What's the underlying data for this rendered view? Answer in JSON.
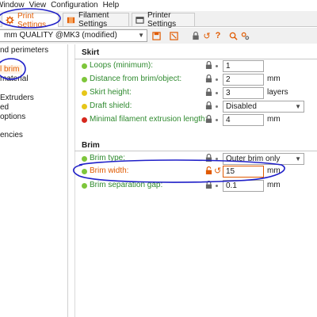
{
  "menu": [
    "Window",
    "View",
    "Configuration",
    "Help"
  ],
  "tabs": [
    {
      "label": "Print Settings",
      "icon": "gear-icon",
      "active": true
    },
    {
      "label": "Filament Settings",
      "icon": "filament-spool-icon",
      "active": false
    },
    {
      "label": "Printer Settings",
      "icon": "printer-icon",
      "active": false
    }
  ],
  "preset": {
    "value": "mm QUALITY @MK3 (modified)",
    "tools": [
      "save-icon",
      "delete-icon",
      "lock-icon",
      "undo-arrow-icon",
      "help-icon",
      "search-icon",
      "compare-icon"
    ]
  },
  "tree": {
    "items": [
      "nd perimeters",
      "l brim",
      "material",
      "Extruders",
      "ed",
      "options",
      "encies"
    ],
    "selected_index": 1
  },
  "sections": {
    "skirt": {
      "title": "Skirt",
      "rows": [
        {
          "label": "Loops (minimum):",
          "value": "1",
          "unit": "",
          "dot": "green"
        },
        {
          "label": "Distance from brim/object:",
          "value": "2",
          "unit": "mm",
          "dot": "green"
        },
        {
          "label": "Skirt height:",
          "value": "3",
          "unit": "layers",
          "dot": "yellow"
        },
        {
          "label": "Draft shield:",
          "value": "Disabled",
          "unit": "",
          "dot": "yellow",
          "type": "combo"
        },
        {
          "label": "Minimal filament extrusion length:",
          "value": "4",
          "unit": "mm",
          "dot": "red"
        }
      ]
    },
    "brim": {
      "title": "Brim",
      "rows": [
        {
          "label": "Brim type:",
          "value": "Outer brim only",
          "unit": "",
          "dot": "green",
          "type": "combo"
        },
        {
          "label": "Brim width:",
          "value": "15",
          "unit": "mm",
          "dot": "green",
          "modified": true
        },
        {
          "label": "Brim separation gap:",
          "value": "0.1",
          "unit": "mm",
          "dot": "green"
        }
      ]
    }
  },
  "colors": {
    "accent": "#e05a00",
    "label_green": "#2f8a2f",
    "dot_green": "#7ec63b",
    "dot_yellow": "#e6c619",
    "dot_red": "#d6281d",
    "annotation": "#1f1fc8"
  }
}
